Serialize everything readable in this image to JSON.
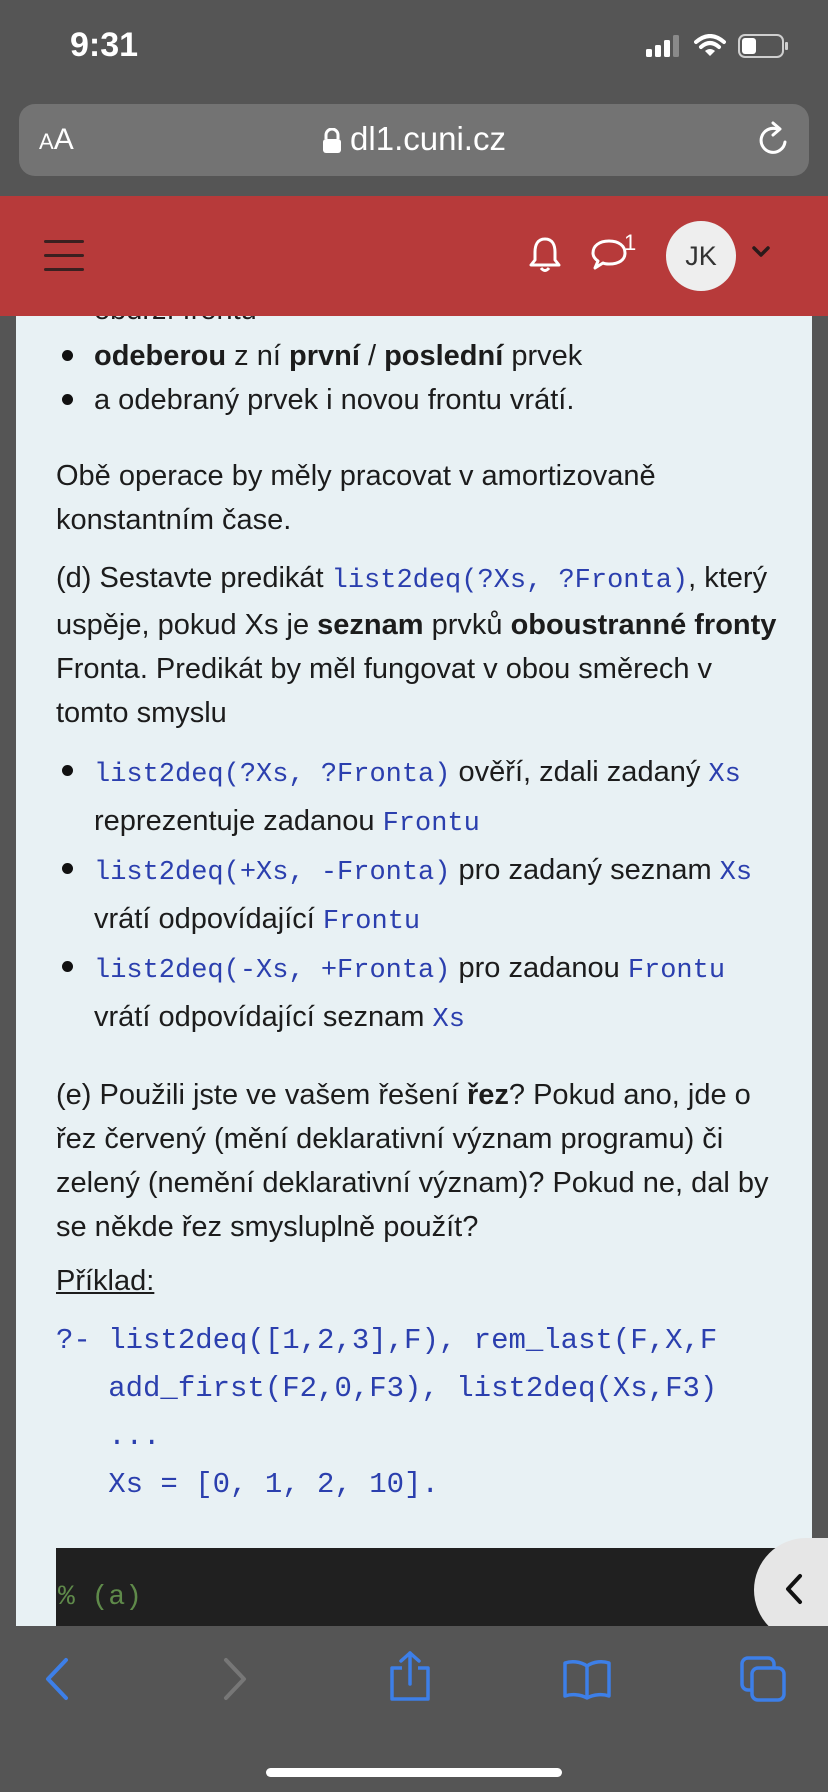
{
  "status_bar": {
    "time": "9:31"
  },
  "url_bar": {
    "aa_small": "A",
    "aa_large": "A",
    "domain": "dl1.cuni.cz"
  },
  "header": {
    "notification_count": "1",
    "avatar_initials": "JK"
  },
  "content": {
    "partial_item": "obdrží frontu",
    "items_top": [
      {
        "b1": "odeberou",
        "t1": " z ní ",
        "b2": "první",
        "t2": " / ",
        "b3": "poslední",
        "t3": " prvek"
      },
      {
        "text": "a odebraný prvek i novou frontu vrátí."
      }
    ],
    "para1": "Obě operace by měly pracovat v amortizovaně konstantním čase.",
    "para_d": {
      "t1": "(d) Sestavte predikát ",
      "code": "list2deq(?Xs, ?Fronta)",
      "t2": ", který uspěje, pokud Xs je ",
      "b1": "seznam",
      "t3": " prvků ",
      "b2": "oboustranné fronty",
      "t4": " Fronta. Predikát by měl fungovat v obou směrech v tomto smyslu"
    },
    "items_d": [
      {
        "code1": "list2deq(?Xs, ?Fronta)",
        "t1": " ověří, zdali zadaný ",
        "code2": "Xs",
        "t2": " reprezentuje zadanou ",
        "code3": "Frontu"
      },
      {
        "code1": "list2deq(+Xs, -Fronta)",
        "t1": " pro zadaný seznam ",
        "code2": "Xs",
        "t2": " vrátí odpovídající ",
        "code3": "Frontu"
      },
      {
        "code1": "list2deq(-Xs, +Fronta)",
        "t1": " pro zadanou ",
        "code2": "Frontu",
        "t2": " vrátí odpovídající seznam ",
        "code3": "Xs"
      }
    ],
    "para_e": {
      "t1": "(e) Použili jste ve vašem řešení ",
      "b1": "řez",
      "t2": "? Pokud ano, jde o řez červený (mění deklarativní význam programu) či zelený (nemění deklarativní význam)? Pokud ne, dal by se někde řez smysluplně použít?"
    },
    "example_label": "Příklad:",
    "code_lines": [
      "?- list2deq([1,2,3],F), rem_last(F,X,F",
      "   add_first(F2,0,F3), list2deq(Xs,F3)",
      "   ...",
      "   Xs = [0, 1, 2, 10]."
    ],
    "dark_code": "% (a)"
  },
  "colors": {
    "header": "#b73a3a",
    "content_bg": "#e8f1f4",
    "code": "#2b3fae",
    "toolbar_icon": "#3d7fe8"
  },
  "icons": [
    "signal-icon",
    "wifi-icon",
    "battery-icon",
    "lock-icon",
    "reload-icon",
    "menu-icon",
    "bell-icon",
    "chat-icon",
    "chevron-down-icon",
    "chevron-left-icon",
    "back-icon",
    "forward-icon",
    "share-icon",
    "bookmarks-icon",
    "tabs-icon"
  ]
}
